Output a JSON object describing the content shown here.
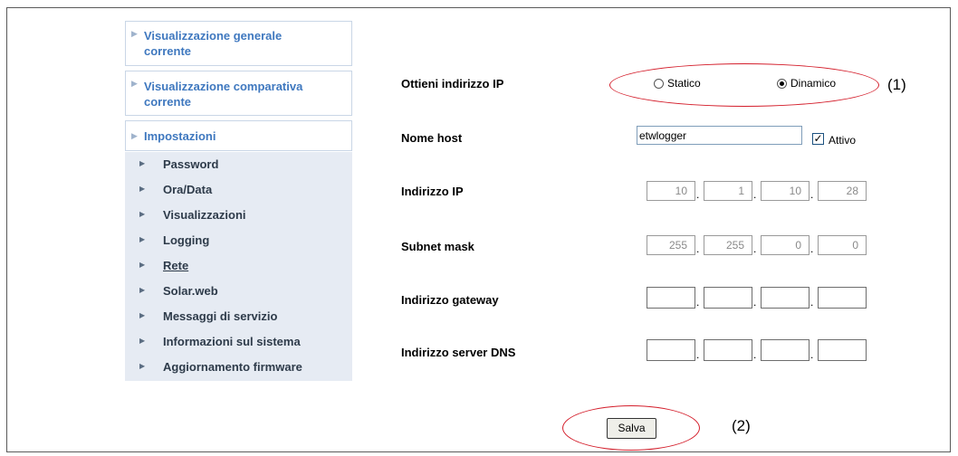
{
  "sidebar": {
    "main": [
      {
        "line1": "Visualizzazione generale",
        "line2": "corrente"
      },
      {
        "line1": "Visualizzazione comparativa",
        "line2": "corrente"
      },
      {
        "line1": "Impostazioni"
      }
    ],
    "items": [
      {
        "label": "Password"
      },
      {
        "label": "Ora/Data"
      },
      {
        "label": "Visualizzazioni"
      },
      {
        "label": "Logging"
      },
      {
        "label": "Rete"
      },
      {
        "label": "Solar.web"
      },
      {
        "label": "Messaggi di servizio"
      },
      {
        "label": "Informazioni sul sistema"
      },
      {
        "label": "Aggiornamento firmware"
      }
    ]
  },
  "form": {
    "ip_mode": {
      "label": "Ottieni indirizzo IP",
      "options": [
        "Statico",
        "Dinamico"
      ],
      "selected": "Dinamico"
    },
    "hostname": {
      "label": "Nome host",
      "value": "etwlogger",
      "active_label": "Attivo",
      "active_checked": true,
      "check_mark": "✓"
    },
    "ip_address": {
      "label": "Indirizzo IP",
      "octets": [
        "10",
        "1",
        "10",
        "28"
      ]
    },
    "subnet_mask": {
      "label": "Subnet mask",
      "octets": [
        "255",
        "255",
        "0",
        "0"
      ]
    },
    "gateway": {
      "label": "Indirizzo gateway",
      "octets": [
        "",
        "",
        "",
        ""
      ]
    },
    "dns": {
      "label": "Indirizzo server DNS",
      "octets": [
        "",
        "",
        "",
        ""
      ]
    },
    "separator": ".",
    "save_label": "Salva"
  },
  "annotations": {
    "one": "(1)",
    "two": "(2)"
  },
  "colors": {
    "accent_link": "#3f78bf",
    "highlight": "#d41f2c",
    "submenu_bg": "#e6ebf3"
  }
}
